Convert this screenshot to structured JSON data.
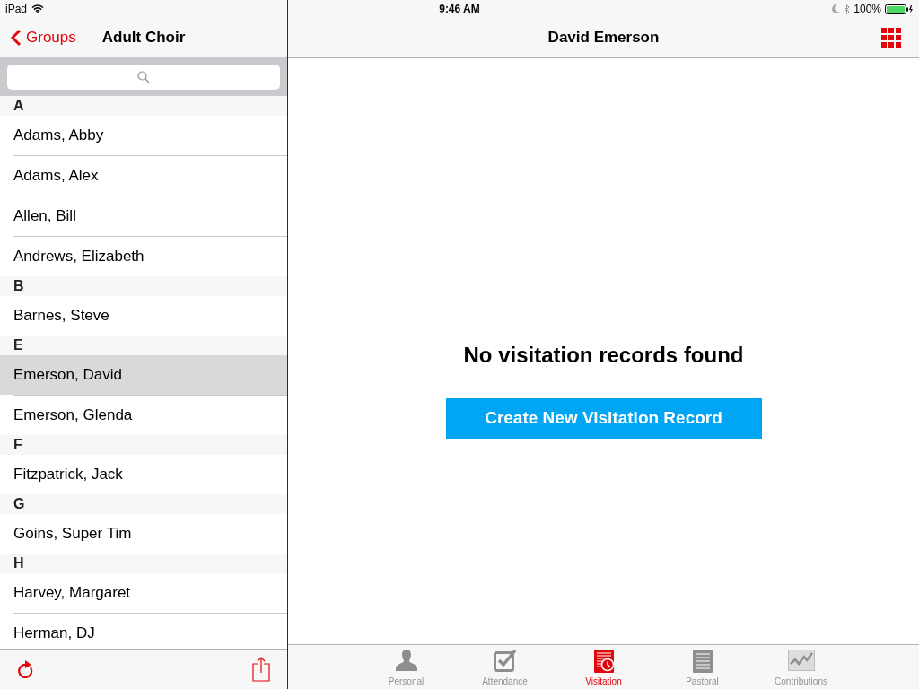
{
  "status_bar": {
    "device": "iPad",
    "time": "9:46 AM",
    "battery": "100%"
  },
  "sidebar": {
    "back_label": "Groups",
    "title": "Adult Choir",
    "sections": [
      {
        "letter": "A",
        "rows": [
          {
            "name": "Adams, Abby",
            "selected": false
          },
          {
            "name": "Adams, Alex",
            "selected": false
          },
          {
            "name": "Allen, Bill",
            "selected": false
          },
          {
            "name": "Andrews, Elizabeth",
            "selected": false
          }
        ]
      },
      {
        "letter": "B",
        "rows": [
          {
            "name": "Barnes, Steve",
            "selected": false
          }
        ]
      },
      {
        "letter": "E",
        "rows": [
          {
            "name": "Emerson, David",
            "selected": true
          },
          {
            "name": "Emerson, Glenda",
            "selected": false
          }
        ]
      },
      {
        "letter": "F",
        "rows": [
          {
            "name": "Fitzpatrick, Jack",
            "selected": false
          }
        ]
      },
      {
        "letter": "G",
        "rows": [
          {
            "name": "Goins, Super Tim",
            "selected": false
          }
        ]
      },
      {
        "letter": "H",
        "rows": [
          {
            "name": "Harvey, Margaret",
            "selected": false
          },
          {
            "name": "Herman, DJ",
            "selected": false
          }
        ]
      }
    ]
  },
  "detail": {
    "title": "David Emerson",
    "message": "No visitation records found",
    "button": "Create New Visitation Record"
  },
  "tabs": [
    {
      "kind": "person",
      "label": "Personal",
      "selected": false
    },
    {
      "kind": "check",
      "label": "Attendance",
      "selected": false
    },
    {
      "kind": "visit",
      "label": "Visitation",
      "selected": true
    },
    {
      "kind": "notes",
      "label": "Pastoral",
      "selected": false
    },
    {
      "kind": "chart",
      "label": "Contributions",
      "selected": false
    }
  ]
}
